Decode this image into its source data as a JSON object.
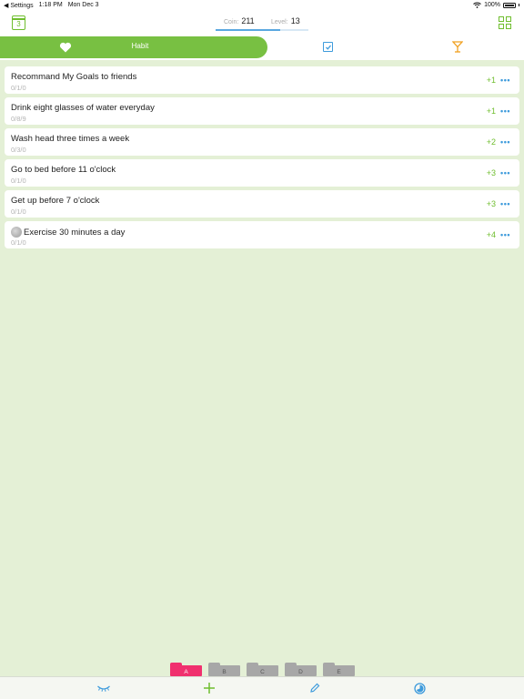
{
  "status_bar": {
    "back_label": "◀ Settings",
    "time": "1:18 PM",
    "date": "Mon Dec 3",
    "battery": "100%"
  },
  "header": {
    "calendar_day": "3",
    "coin_label": "Coin:",
    "coin_value": "211",
    "level_label": "Level:",
    "level_value": "13",
    "level_progress": 0.7
  },
  "tabs": {
    "habit_label": "Habit",
    "todo_icon": "checkbox-icon",
    "reward_icon": "cocktail-icon"
  },
  "habits": [
    {
      "title": "Recommand My Goals to friends",
      "progress": "0/1/0",
      "score": "+1",
      "more": "•••",
      "icon": ""
    },
    {
      "title": "Drink eight glasses of water everyday",
      "progress": "0/8/9",
      "score": "+1",
      "more": "•••",
      "icon": ""
    },
    {
      "title": "Wash head three times a week",
      "progress": "0/3/0",
      "score": "+2",
      "more": "•••",
      "icon": ""
    },
    {
      "title": "Go to bed before 11 o'clock",
      "progress": "0/1/0",
      "score": "+3",
      "more": "•••",
      "icon": ""
    },
    {
      "title": "Get up before 7 o'clock",
      "progress": "0/1/0",
      "score": "+3",
      "more": "•••",
      "icon": ""
    },
    {
      "title": "Exercise 30 minutes a day",
      "progress": "0/1/0",
      "score": "+4",
      "more": "•••",
      "icon": "stone-icon"
    }
  ],
  "folders": [
    "A",
    "B",
    "C",
    "D",
    "E"
  ],
  "active_folder": "A",
  "toolbar": {
    "items": [
      "eye-closed-icon",
      "add-icon",
      "pencil-icon",
      "stats-circle-icon"
    ]
  },
  "colors": {
    "accent_green": "#78c042",
    "accent_blue": "#3e9bdc",
    "background": "#e4f0d6",
    "active_folder": "#f0306e"
  }
}
